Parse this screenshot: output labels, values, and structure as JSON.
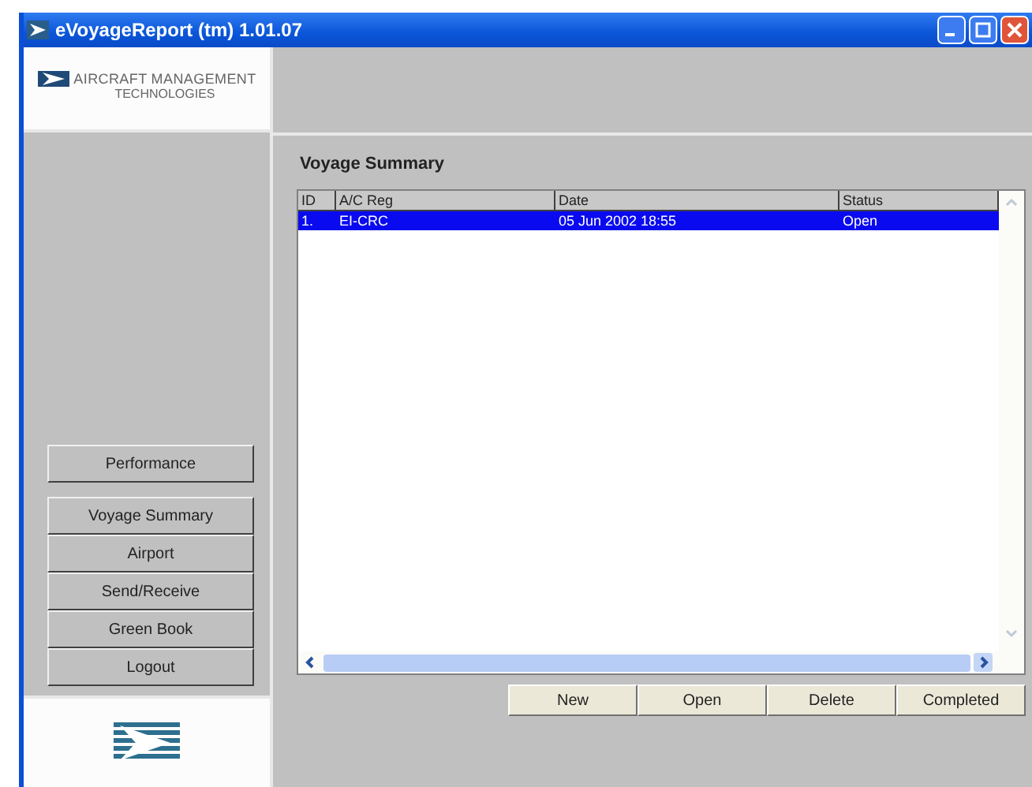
{
  "window": {
    "title": "eVoyageReport (tm) 1.01.07"
  },
  "logo": {
    "line1": "AIRCRAFT MANAGEMENT",
    "line2": "TECHNOLOGIES"
  },
  "sidebar": {
    "buttons": [
      "Performance",
      "Voyage Summary",
      "Airport",
      "Send/Receive",
      "Green Book",
      "Logout"
    ]
  },
  "heading": "Voyage Summary",
  "table": {
    "columns": [
      "ID",
      "A/C Reg",
      "Date",
      "Status"
    ],
    "rows": [
      {
        "cells": [
          "1.",
          "EI-CRC",
          "05 Jun 2002 18:55",
          "Open"
        ],
        "selected": true
      }
    ]
  },
  "buttons": [
    "New",
    "Open",
    "Delete",
    "Completed"
  ]
}
